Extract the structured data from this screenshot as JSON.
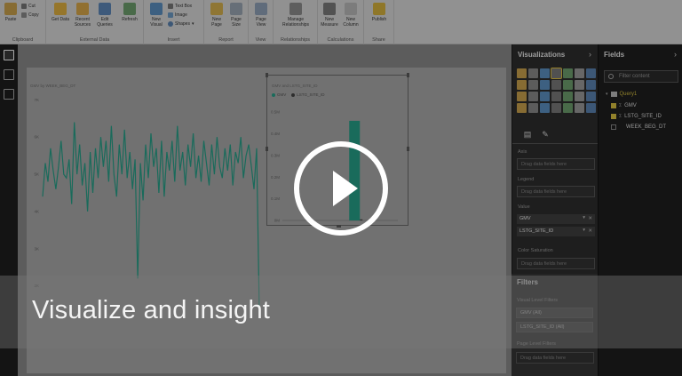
{
  "ribbon": {
    "groups": [
      {
        "label": "Clipboard"
      },
      {
        "label": "External Data"
      },
      {
        "label": "Insert"
      },
      {
        "label": "Report"
      },
      {
        "label": "View"
      },
      {
        "label": "Relationships"
      },
      {
        "label": "Calculations"
      },
      {
        "label": "Share"
      }
    ],
    "paste": "Paste",
    "cut": "Cut",
    "copy": "Copy",
    "get_data": "Get Data",
    "recent_sources": "Recent Sources",
    "edit_queries": "Edit Queries",
    "refresh": "Refresh",
    "new_visual": "New Visual",
    "text_box": "Text Box",
    "image": "Image",
    "shapes": "Shapes",
    "new_page": "New Page",
    "page_size": "Page Size",
    "page_view": "Page View",
    "manage_relationships": "Manage Relationships",
    "new_measure": "New Measure",
    "new_column": "New Column",
    "publish": "Publish"
  },
  "canvas": {
    "line_chart_title": "GMV by WEEK_BEG_DT",
    "bar_chart_title": "GMV and LSTG_SITE_ID"
  },
  "chart_data": [
    {
      "type": "line",
      "title": "GMV by WEEK_BEG_DT",
      "xlabel": "",
      "ylabel": "",
      "y_ticks": [
        "2K",
        "3K",
        "4K",
        "5K",
        "6K",
        "7K"
      ],
      "ylim": [
        1.8,
        7.2
      ],
      "series": [
        {
          "values": [
            4.4,
            5.3,
            4.8,
            5.7,
            5.1,
            4.6,
            5.2,
            5.9,
            5.0,
            4.9,
            5.4,
            4.2,
            6.4,
            5.0,
            5.8,
            4.7,
            5.3,
            4.0,
            5.6,
            4.5,
            5.7,
            4.9,
            6.0,
            5.2,
            5.9,
            4.8,
            6.3,
            5.0,
            4.4,
            5.8,
            5.0,
            6.2,
            4.9,
            5.6,
            4.6,
            5.4,
            2.2,
            5.3,
            4.3,
            5.8,
            4.9,
            6.1,
            5.2,
            5.7,
            4.5,
            5.9,
            4.4,
            5.6,
            5.1,
            5.9,
            4.8,
            6.3,
            5.1,
            5.6,
            4.7,
            5.8,
            5.2,
            6.1,
            4.9,
            5.5,
            4.8,
            5.9,
            5.3,
            4.7,
            5.8,
            5.0,
            6.0,
            5.2,
            4.9,
            5.7,
            5.1,
            5.8,
            4.7,
            5.6,
            5.3,
            6.0,
            4.9,
            5.5,
            5.8,
            5.2,
            4.6,
            5.7,
            1.3
          ]
        }
      ]
    },
    {
      "type": "bar",
      "title": "GMV and LSTG_SITE_ID",
      "legend": [
        "GMV",
        "LSTG_SITE_ID"
      ],
      "legend_colors": [
        "#26a088",
        "#444444"
      ],
      "y_ticks": [
        "0M",
        "0.1M",
        "0.2M",
        "0.3M",
        "0.4M",
        "0.5M"
      ],
      "categories": [
        "",
        "",
        "",
        ""
      ],
      "series": [
        {
          "name": "GMV",
          "values": [
            0,
            0,
            0.46,
            0
          ]
        },
        {
          "name": "LSTG_SITE_ID",
          "values": [
            0,
            0,
            0.005,
            0
          ]
        }
      ],
      "ylim": [
        0,
        0.55
      ]
    }
  ],
  "viz_pane": {
    "title": "Visualizations",
    "axis_label": "Axis",
    "legend_label": "Legend",
    "value_label": "Value",
    "color_saturation_label": "Color Saturation",
    "drop_hint": "Drag data fields here",
    "value_fields": [
      "GMV",
      "LSTG_SITE_ID"
    ]
  },
  "filters": {
    "title": "Filters",
    "visual_level": "Visual Level Filters",
    "items": [
      "GMV (All)",
      "LSTG_SITE_ID (All)"
    ],
    "page_level": "Page Level Filters",
    "drop_hint": "Drag data fields here"
  },
  "fields_pane": {
    "title": "Fields",
    "search_placeholder": "Filter content",
    "table_name": "Query1",
    "fields": [
      {
        "name": "GMV",
        "checked": true
      },
      {
        "name": "LSTG_SITE_ID",
        "checked": true
      },
      {
        "name": "WEEK_BEG_DT",
        "checked": false
      }
    ]
  },
  "video": {
    "caption": "Visualize and insight"
  },
  "colors": {
    "accent_teal": "#26a088",
    "selection_yellow": "#d8c040"
  }
}
